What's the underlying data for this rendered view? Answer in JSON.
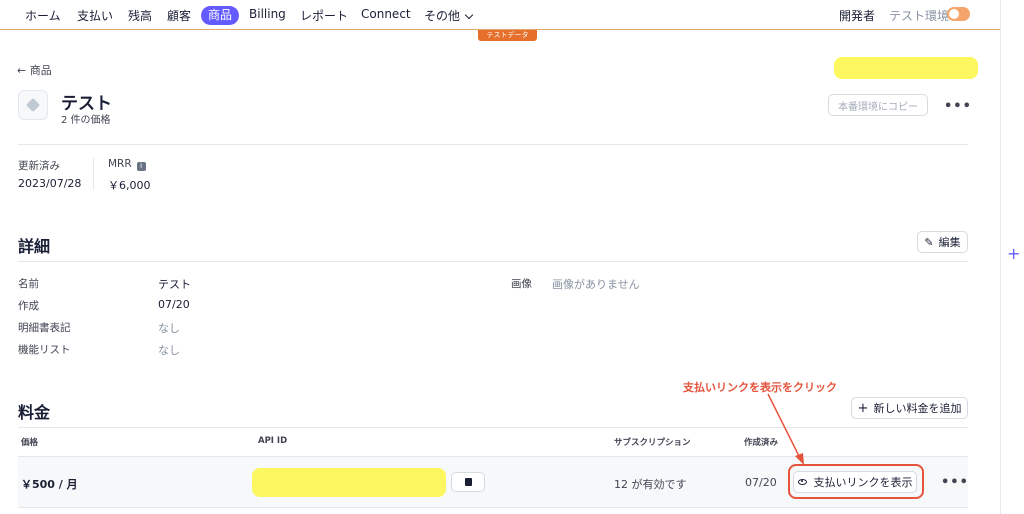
{
  "nav": {
    "items": [
      "ホーム",
      "支払い",
      "残高",
      "顧客",
      "商品",
      "Billing",
      "レポート",
      "Connect",
      "その他"
    ],
    "active": "商品",
    "developer": "開発者",
    "test_env": "テスト環境",
    "test_data_badge": "テストデータ"
  },
  "colors": {
    "accent": "#635bff",
    "highlight": "#e5533b",
    "redacted": "#fcf75e",
    "test_orange": "#e56f2b"
  },
  "back_link": "← 商品",
  "product": {
    "name": "テスト",
    "price_count": "2 件の価格",
    "copy_button": "本番環境にコピー",
    "more": "•••"
  },
  "summary": {
    "updated_label": "更新済み",
    "updated_value": "2023/07/28",
    "mrr_label": "MRR",
    "mrr_value": "￥6,000"
  },
  "details": {
    "heading": "詳細",
    "edit_button": "編集",
    "rows": [
      {
        "label": "名前",
        "value": "テスト"
      },
      {
        "label": "作成",
        "value": "07/20"
      },
      {
        "label": "明細書表記",
        "value": "なし"
      },
      {
        "label": "機能リスト",
        "value": "なし"
      }
    ],
    "image_label": "画像",
    "image_value": "画像がありません"
  },
  "pricing": {
    "heading": "料金",
    "add_button": "新しい料金を追加",
    "columns": [
      "価格",
      "API ID",
      "サブスクリプション",
      "作成済み"
    ],
    "row": {
      "price": "￥500 / 月",
      "subscriptions": "12 が有効です",
      "created": "07/20",
      "paylink_button": "支払いリンクを表示",
      "more": "•••"
    }
  },
  "annotation": "支払いリンクを表示をクリック"
}
